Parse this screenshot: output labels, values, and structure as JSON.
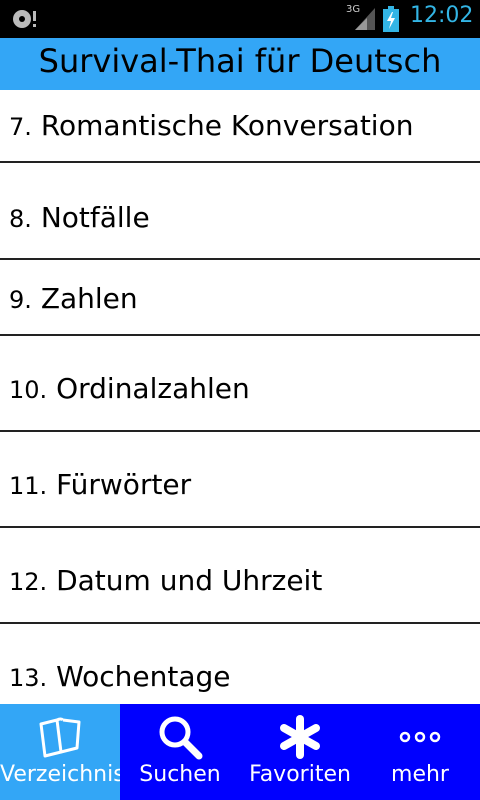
{
  "status_bar": {
    "network": "3G",
    "time": "12:02",
    "icons": [
      "sd-card-icon",
      "signal-icon",
      "battery-charging-icon"
    ]
  },
  "title_bar": {
    "title": "Survival-Thai für Deutsch"
  },
  "list": {
    "items": [
      {
        "number": "7.",
        "label": "Romantische Konversation"
      },
      {
        "number": "8.",
        "label": "Notfälle"
      },
      {
        "number": "9.",
        "label": "Zahlen"
      },
      {
        "number": "10.",
        "label": "Ordinalzahlen"
      },
      {
        "number": "11.",
        "label": "Fürwörter"
      },
      {
        "number": "12.",
        "label": "Datum und Uhrzeit"
      },
      {
        "number": "13.",
        "label": "Wochentage"
      }
    ]
  },
  "bottom_nav": {
    "tabs": [
      {
        "label": "Verzeichnis",
        "icon": "book-icon",
        "active": true
      },
      {
        "label": "Suchen",
        "icon": "search-icon",
        "active": false
      },
      {
        "label": "Favoriten",
        "icon": "asterisk-icon",
        "active": false
      },
      {
        "label": "mehr",
        "icon": "more-icon",
        "active": false
      }
    ]
  },
  "colors": {
    "title_bar": "#33a6f6",
    "bottom_nav": "#0000ff",
    "active_tab": "#33a6f6",
    "time": "#33b5e5"
  }
}
